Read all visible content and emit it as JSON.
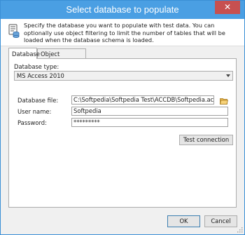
{
  "window": {
    "title": "Select database to populate",
    "close_glyph": "✕"
  },
  "header": {
    "icon": "database-icon",
    "intro_text": "Specify the database you want to populate with test data. You can optionally use object filtering to limit the number of tables that will be loaded when the database schema is loaded."
  },
  "tabs": [
    {
      "label": "Database",
      "active": true
    },
    {
      "label": "Object filtering",
      "active": false
    }
  ],
  "database": {
    "type_label": "Database type:",
    "type_value": "MS Access 2010",
    "file_label": "Database file:",
    "file_value": "C:\\Softpedia\\Softpedia Test\\ACCDB\\Softpedia.accdb",
    "file_browse_icon": "folder-open-icon",
    "user_label": "User name:",
    "user_value": "Softpedia",
    "password_label": "Password:",
    "password_value": "*********",
    "test_button": "Test connection"
  },
  "footer": {
    "ok": "OK",
    "cancel": "Cancel"
  },
  "colors": {
    "titlebar": "#4a9fe3",
    "close_button": "#c75050",
    "button_face": "#e5e5e5",
    "dialog_bg": "#f0f0f0"
  }
}
